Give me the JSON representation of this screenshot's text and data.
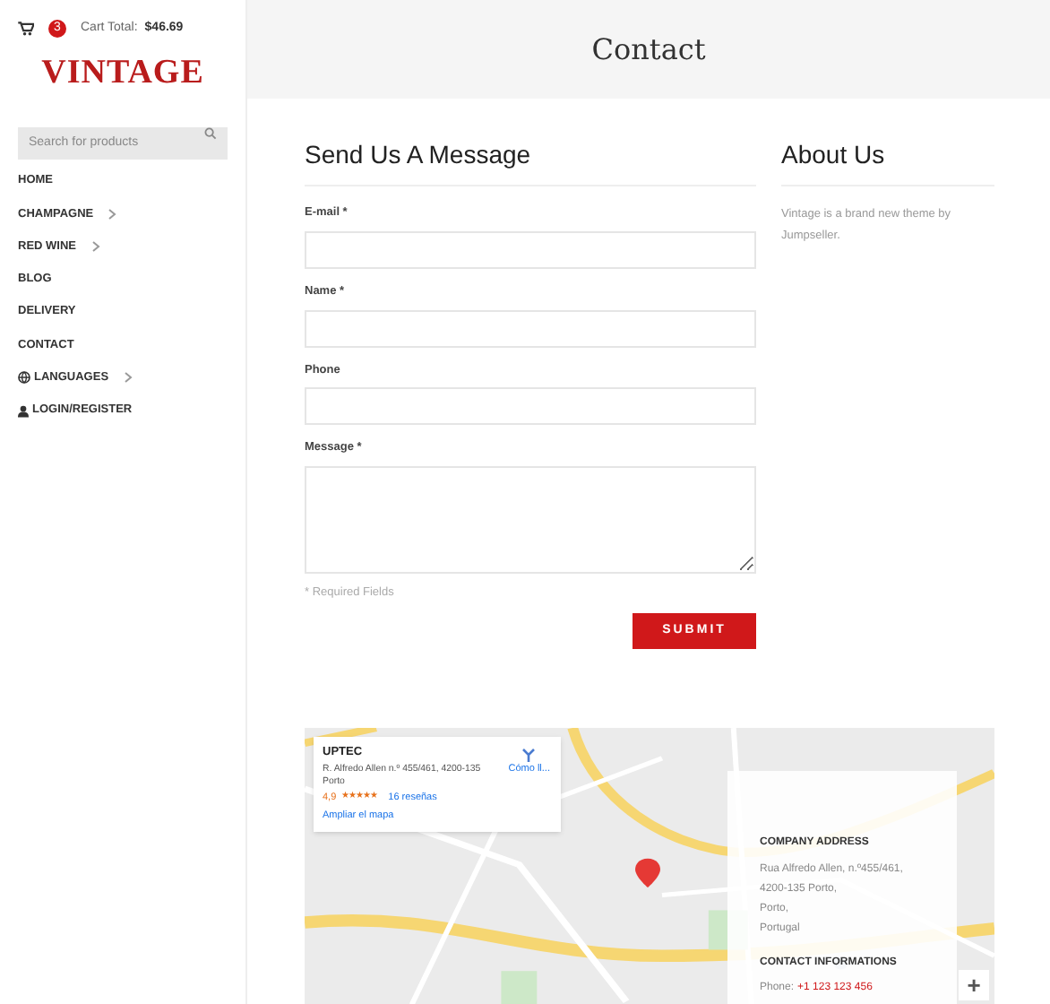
{
  "cart": {
    "count": "3",
    "label": "Cart Total:",
    "total": "$46.69"
  },
  "logo": "VINTAGE",
  "search": {
    "placeholder": "Search for products"
  },
  "nav": [
    {
      "label": "HOME",
      "submenu": false,
      "kind": "plain"
    },
    {
      "label": "CHAMPAGNE",
      "submenu": true,
      "kind": "plain"
    },
    {
      "label": "RED WINE",
      "submenu": true,
      "kind": "plain"
    },
    {
      "label": "BLOG",
      "submenu": false,
      "kind": "plain"
    },
    {
      "label": "DELIVERY",
      "submenu": false,
      "kind": "plain"
    },
    {
      "label": "CONTACT",
      "submenu": false,
      "kind": "plain"
    },
    {
      "label": "LANGUAGES",
      "submenu": true,
      "kind": "globe"
    },
    {
      "label": "LOGIN/REGISTER",
      "submenu": false,
      "kind": "user"
    }
  ],
  "page_title": "Contact",
  "form": {
    "heading": "Send Us A Message",
    "fields": [
      {
        "label": "E-mail *",
        "kind": "input"
      },
      {
        "label": "Name *",
        "kind": "input"
      },
      {
        "label": "Phone",
        "kind": "input"
      },
      {
        "label": "Message *",
        "kind": "textarea"
      }
    ],
    "note": "* Required Fields",
    "submit": "SUBMIT"
  },
  "about": {
    "heading": "About Us",
    "text": "Vintage is a brand new theme by Jumpseller."
  },
  "map": {
    "kind": "picture",
    "place_card": {
      "name": "UPTEC",
      "address": "R. Alfredo Allen n.º 455/461, 4200-135 Porto",
      "rating": "4,9",
      "stars": 5,
      "reviews": "16 reseñas",
      "directions": "Cómo ll...",
      "enlarge": "Ampliar el mapa"
    },
    "zoom_in": "+"
  },
  "contact_panel": {
    "address_heading": "COMPANY ADDRESS",
    "address_lines": [
      "Rua Alfredo Allen, n.º455/461,",
      "4200-135 Porto,",
      "Porto,",
      "Portugal"
    ],
    "info_heading": "CONTACT INFORMATIONS",
    "phone_label": "Phone:",
    "phone": "+1 123 123 456"
  }
}
